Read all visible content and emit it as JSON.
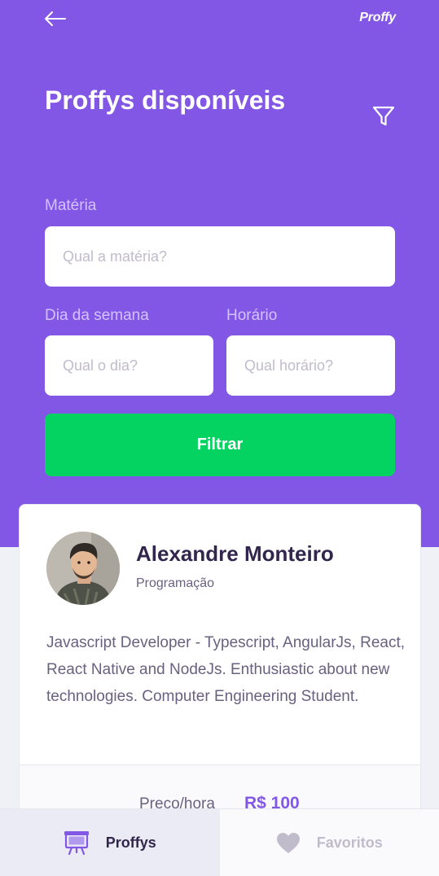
{
  "header": {
    "logo": "Proffy",
    "title": "Proffys disponíveis"
  },
  "filters": {
    "subject_label": "Matéria",
    "subject_placeholder": "Qual a matéria?",
    "weekday_label": "Dia da semana",
    "weekday_placeholder": "Qual o dia?",
    "time_label": "Horário",
    "time_placeholder": "Qual horário?",
    "button_label": "Filtrar"
  },
  "teacher": {
    "name": "Alexandre Monteiro",
    "subject": "Programação",
    "bio": "Javascript Developer - Typescript, AngularJs, React, React Native and NodeJs. Enthusiastic about new technologies. Computer Engineering Student.",
    "price_label": "Preço/hora",
    "price_value": "R$ 100"
  },
  "tabs": [
    {
      "label": "Proffys",
      "icon": "easel-icon",
      "active": true
    },
    {
      "label": "Favoritos",
      "icon": "heart-icon",
      "active": false
    }
  ],
  "colors": {
    "primary": "#8257E5",
    "secondary": "#04D361",
    "title": "#32264D",
    "text": "#6A6180"
  }
}
